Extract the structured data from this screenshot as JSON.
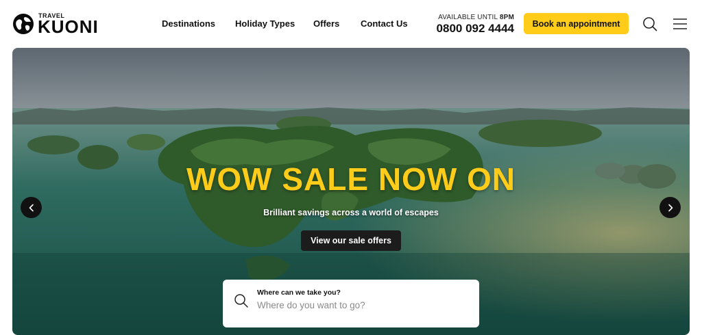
{
  "header": {
    "logo": {
      "small_text": "TRAVEL",
      "brand": "KUONI"
    },
    "nav": [
      "Destinations",
      "Holiday Types",
      "Offers",
      "Contact Us"
    ],
    "availability": {
      "prefix": "AVAILABLE UNTIL",
      "time": "8PM"
    },
    "phone": "0800 092 4444",
    "book_label": "Book an appointment",
    "icons": [
      "search-icon",
      "menu-icon"
    ],
    "accent_color": "#ffcc1a"
  },
  "hero": {
    "title": "WOW SALE NOW ON",
    "subtitle": "Brilliant savings across a world of escapes",
    "cta_label": "View our sale offers",
    "prev_icon": "chevron-left-icon",
    "next_icon": "chevron-right-icon"
  },
  "search": {
    "label": "Where can we take you?",
    "placeholder": "Where do you want to go?"
  }
}
